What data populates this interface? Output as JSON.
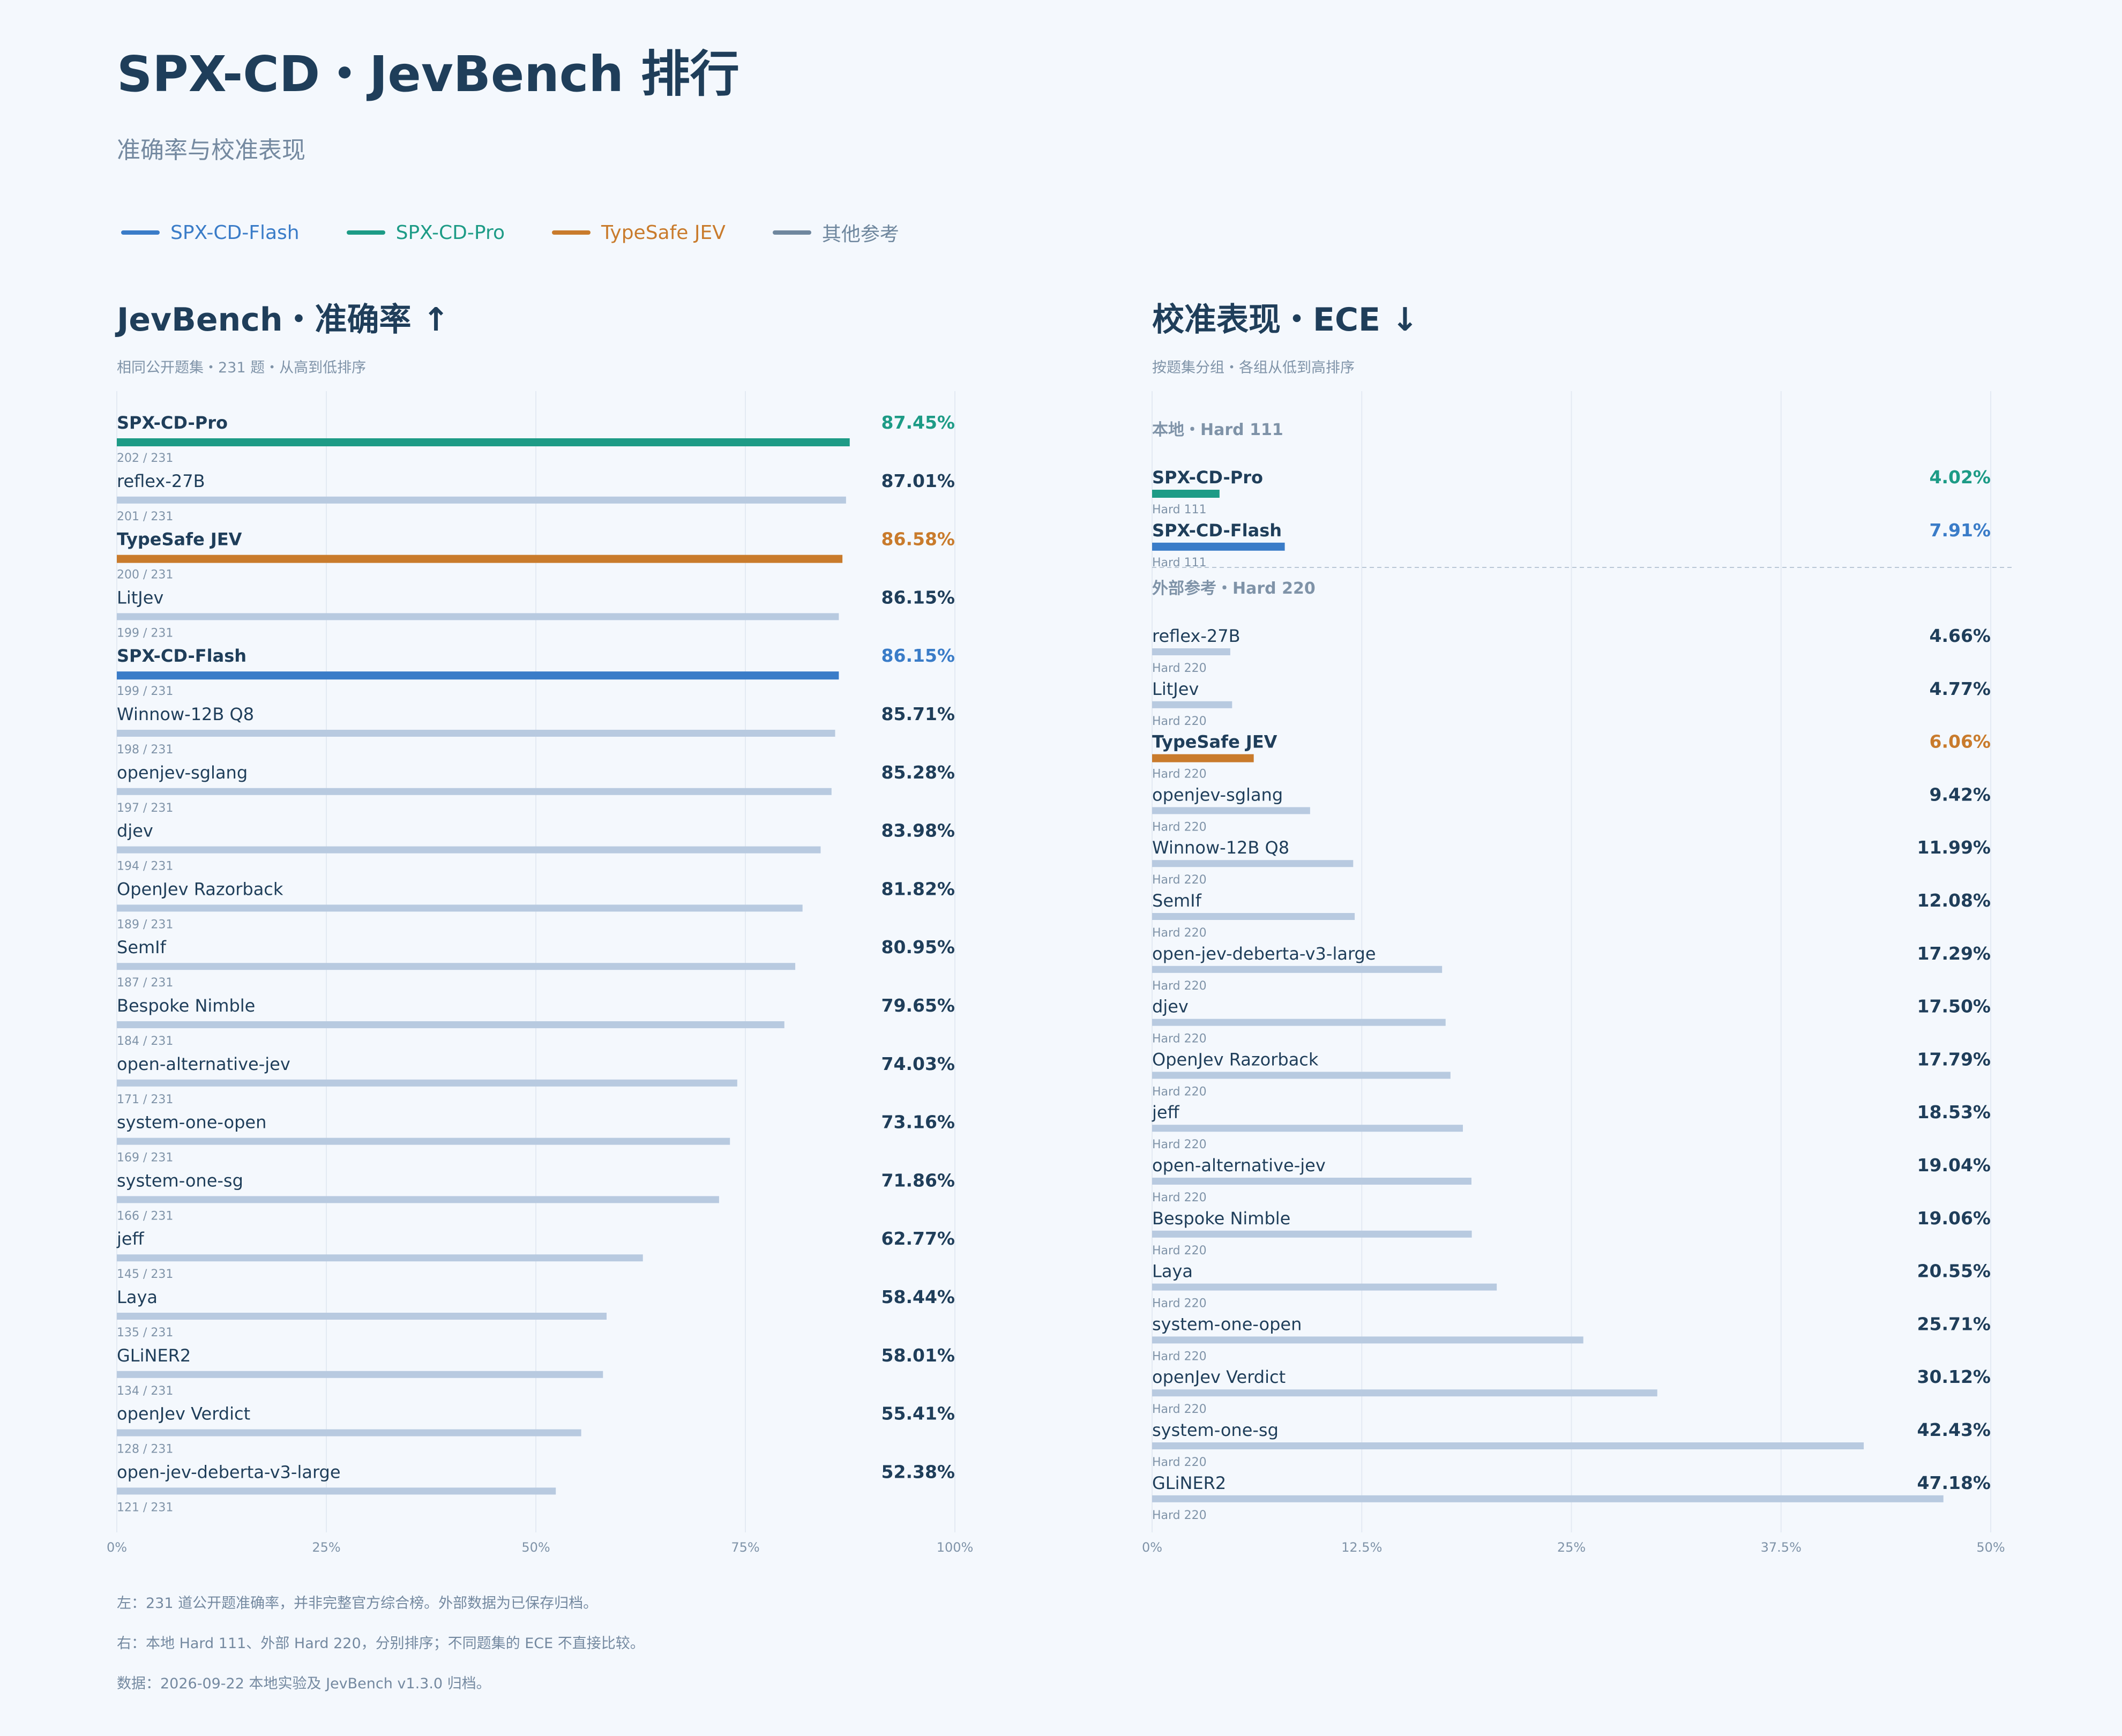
{
  "title": "SPX-CD・JevBench 排行",
  "subtitle": "准确率与校准表现",
  "legend": [
    {
      "label": "SPX-CD-Flash",
      "color": "#3a7cc8"
    },
    {
      "label": "SPX-CD-Pro",
      "color": "#1d9b86"
    },
    {
      "label": "TypeSafe JEV",
      "color": "#c97b2c"
    },
    {
      "label": "其他参考",
      "color": "#6f879e"
    }
  ],
  "colors": {
    "flash": "#3a7cc8",
    "pro": "#1d9b86",
    "typesafe": "#c97b2c",
    "other_bar": "#b8cae0",
    "text_dark": "#1f3e5a",
    "text_muted": "#7f93a8",
    "grid": "#e3eaf3"
  },
  "left_panel": {
    "title": "JevBench・准确率 ↑",
    "subtitle": "相同公开题集・231 题・从高到低排序"
  },
  "right_panel": {
    "title": "校准表现・ECE ↓",
    "subtitle": "按题集分组・各组从低到高排序"
  },
  "footer": [
    "左：231 道公开题准确率，并非完整官方综合榜。外部数据为已保存归档。",
    "右：本地 Hard 111、外部 Hard 220，分别排序；不同题集的 ECE 不直接比较。",
    "数据：2026-09-22 本地实验及 JevBench v1.3.0 归档。"
  ],
  "chart_data": [
    {
      "type": "bar",
      "orientation": "horizontal",
      "title": "JevBench・准确率 ↑",
      "xlim": [
        0,
        100
      ],
      "x_ticks": [
        "0%",
        "25%",
        "50%",
        "75%",
        "100%"
      ],
      "grid": true,
      "rows": [
        {
          "name": "SPX-CD-Pro",
          "value": 87.45,
          "label": "87.45%",
          "sub": "202 / 231",
          "group": "pro"
        },
        {
          "name": "reflex-27B",
          "value": 87.01,
          "label": "87.01%",
          "sub": "201 / 231",
          "group": "other"
        },
        {
          "name": "TypeSafe JEV",
          "value": 86.58,
          "label": "86.58%",
          "sub": "200 / 231",
          "group": "typesafe"
        },
        {
          "name": "LitJev",
          "value": 86.15,
          "label": "86.15%",
          "sub": "199 / 231",
          "group": "other"
        },
        {
          "name": "SPX-CD-Flash",
          "value": 86.15,
          "label": "86.15%",
          "sub": "199 / 231",
          "group": "flash"
        },
        {
          "name": "Winnow-12B Q8",
          "value": 85.71,
          "label": "85.71%",
          "sub": "198 / 231",
          "group": "other"
        },
        {
          "name": "openjev-sglang",
          "value": 85.28,
          "label": "85.28%",
          "sub": "197 / 231",
          "group": "other"
        },
        {
          "name": "djev",
          "value": 83.98,
          "label": "83.98%",
          "sub": "194 / 231",
          "group": "other"
        },
        {
          "name": "OpenJev Razorback",
          "value": 81.82,
          "label": "81.82%",
          "sub": "189 / 231",
          "group": "other"
        },
        {
          "name": "SemIf",
          "value": 80.95,
          "label": "80.95%",
          "sub": "187 / 231",
          "group": "other"
        },
        {
          "name": "Bespoke Nimble",
          "value": 79.65,
          "label": "79.65%",
          "sub": "184 / 231",
          "group": "other"
        },
        {
          "name": "open-alternative-jev",
          "value": 74.03,
          "label": "74.03%",
          "sub": "171 / 231",
          "group": "other"
        },
        {
          "name": "system-one-open",
          "value": 73.16,
          "label": "73.16%",
          "sub": "169 / 231",
          "group": "other"
        },
        {
          "name": "system-one-sg",
          "value": 71.86,
          "label": "71.86%",
          "sub": "166 / 231",
          "group": "other"
        },
        {
          "name": "jeff",
          "value": 62.77,
          "label": "62.77%",
          "sub": "145 / 231",
          "group": "other"
        },
        {
          "name": "Laya",
          "value": 58.44,
          "label": "58.44%",
          "sub": "135 / 231",
          "group": "other"
        },
        {
          "name": "GLiNER2",
          "value": 58.01,
          "label": "58.01%",
          "sub": "134 / 231",
          "group": "other"
        },
        {
          "name": "openJev Verdict",
          "value": 55.41,
          "label": "55.41%",
          "sub": "128 / 231",
          "group": "other"
        },
        {
          "name": "open-jev-deberta-v3-large",
          "value": 52.38,
          "label": "52.38%",
          "sub": "121 / 231",
          "group": "other"
        }
      ]
    },
    {
      "type": "bar",
      "orientation": "horizontal",
      "title": "校准表现・ECE ↓",
      "xlim": [
        0,
        50
      ],
      "x_ticks": [
        "0%",
        "12.5%",
        "25%",
        "37.5%",
        "50%"
      ],
      "grid": true,
      "groups": [
        {
          "heading": "本地・Hard 111",
          "rows": [
            {
              "name": "SPX-CD-Pro",
              "value": 4.02,
              "label": "4.02%",
              "sub": "Hard 111",
              "group": "pro"
            },
            {
              "name": "SPX-CD-Flash",
              "value": 7.91,
              "label": "7.91%",
              "sub": "Hard 111",
              "group": "flash"
            }
          ]
        },
        {
          "heading": "外部参考・Hard 220",
          "rows": [
            {
              "name": "reflex-27B",
              "value": 4.66,
              "label": "4.66%",
              "sub": "Hard 220",
              "group": "other"
            },
            {
              "name": "LitJev",
              "value": 4.77,
              "label": "4.77%",
              "sub": "Hard 220",
              "group": "other"
            },
            {
              "name": "TypeSafe JEV",
              "value": 6.06,
              "label": "6.06%",
              "sub": "Hard 220",
              "group": "typesafe"
            },
            {
              "name": "openjev-sglang",
              "value": 9.42,
              "label": "9.42%",
              "sub": "Hard 220",
              "group": "other"
            },
            {
              "name": "Winnow-12B Q8",
              "value": 11.99,
              "label": "11.99%",
              "sub": "Hard 220",
              "group": "other"
            },
            {
              "name": "SemIf",
              "value": 12.08,
              "label": "12.08%",
              "sub": "Hard 220",
              "group": "other"
            },
            {
              "name": "open-jev-deberta-v3-large",
              "value": 17.29,
              "label": "17.29%",
              "sub": "Hard 220",
              "group": "other"
            },
            {
              "name": "djev",
              "value": 17.5,
              "label": "17.50%",
              "sub": "Hard 220",
              "group": "other"
            },
            {
              "name": "OpenJev Razorback",
              "value": 17.79,
              "label": "17.79%",
              "sub": "Hard 220",
              "group": "other"
            },
            {
              "name": "jeff",
              "value": 18.53,
              "label": "18.53%",
              "sub": "Hard 220",
              "group": "other"
            },
            {
              "name": "open-alternative-jev",
              "value": 19.04,
              "label": "19.04%",
              "sub": "Hard 220",
              "group": "other"
            },
            {
              "name": "Bespoke Nimble",
              "value": 19.06,
              "label": "19.06%",
              "sub": "Hard 220",
              "group": "other"
            },
            {
              "name": "Laya",
              "value": 20.55,
              "label": "20.55%",
              "sub": "Hard 220",
              "group": "other"
            },
            {
              "name": "system-one-open",
              "value": 25.71,
              "label": "25.71%",
              "sub": "Hard 220",
              "group": "other"
            },
            {
              "name": "openJev Verdict",
              "value": 30.12,
              "label": "30.12%",
              "sub": "Hard 220",
              "group": "other"
            },
            {
              "name": "system-one-sg",
              "value": 42.43,
              "label": "42.43%",
              "sub": "Hard 220",
              "group": "other"
            },
            {
              "name": "GLiNER2",
              "value": 47.18,
              "label": "47.18%",
              "sub": "Hard 220",
              "group": "other"
            }
          ]
        }
      ]
    }
  ]
}
